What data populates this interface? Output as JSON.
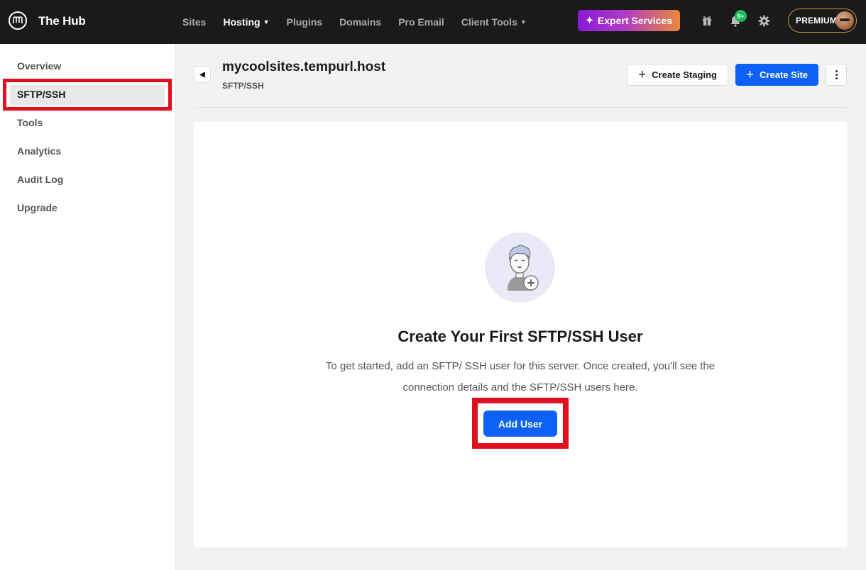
{
  "app": {
    "brand": "The Hub"
  },
  "topnav": {
    "items": [
      {
        "label": "Sites",
        "active": false,
        "dropdown": false
      },
      {
        "label": "Hosting",
        "active": true,
        "dropdown": true
      },
      {
        "label": "Plugins",
        "active": false,
        "dropdown": false
      },
      {
        "label": "Domains",
        "active": false,
        "dropdown": false
      },
      {
        "label": "Pro Email",
        "active": false,
        "dropdown": false
      },
      {
        "label": "Client Tools",
        "active": false,
        "dropdown": true
      }
    ],
    "expert_label": "Expert Services",
    "notification_count": "9+",
    "plan_label": "PREMIUM"
  },
  "sidebar": {
    "items": [
      {
        "label": "Overview"
      },
      {
        "label": "SFTP/SSH"
      },
      {
        "label": "Tools"
      },
      {
        "label": "Analytics"
      },
      {
        "label": "Audit Log"
      },
      {
        "label": "Upgrade"
      }
    ],
    "active_label": "SFTP/SSH"
  },
  "header": {
    "title": "mycoolsites.tempurl.host",
    "subtitle": "SFTP/SSH",
    "staging_label": "Create Staging",
    "create_site_label": "Create Site"
  },
  "empty_state": {
    "title": "Create Your First SFTP/SSH User",
    "description": "To get started, add an SFTP/ SSH user for this server. Once created, you'll see the connection details and the SFTP/SSH users here.",
    "button_label": "Add User"
  },
  "colors": {
    "topbar": "#1a1a1a",
    "primary": "#0d62f5",
    "highlight": "#e0101e",
    "badge": "#1abc5b"
  }
}
